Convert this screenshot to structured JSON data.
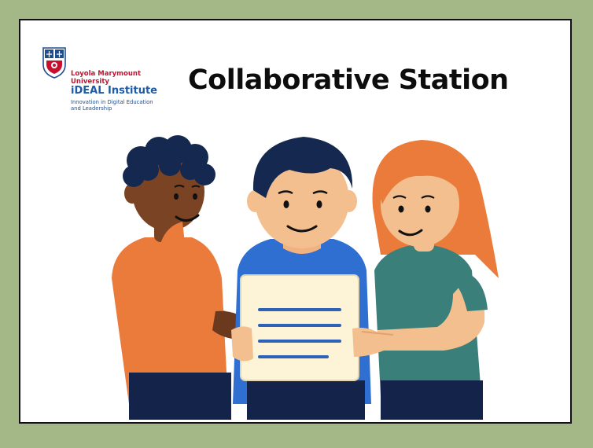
{
  "logo": {
    "university_line1": "Loyola Marymount",
    "university_line2": "University",
    "institute": "iDEAL Institute",
    "tagline_line1": "Innovation in Digital Education",
    "tagline_line2": "and Leadership",
    "colors": {
      "red": "#c8102e",
      "blue": "#1f5aa6"
    }
  },
  "page": {
    "title": "Collaborative Station",
    "background": "#a3b787"
  },
  "illustration": {
    "subject": "three-students-reading-document",
    "colors": {
      "left_shirt": "#ea7b3a",
      "center_shirt": "#2f6fd1",
      "right_shirt": "#3a7f7a",
      "paper": "#fdf3d6",
      "paper_lines": "#2c63b8",
      "pants": "#13234a"
    }
  }
}
